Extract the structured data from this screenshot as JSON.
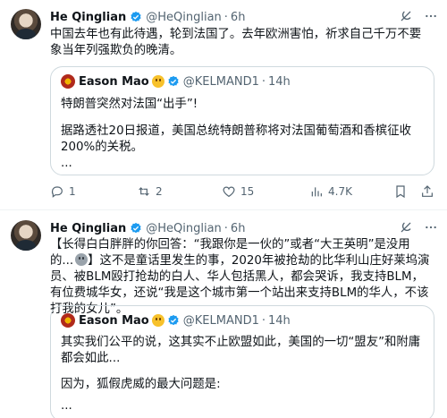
{
  "tweets": [
    {
      "author": {
        "name": "He Qinglian",
        "handle": "@HeQinglian",
        "time": "6h"
      },
      "text": "中国去年也有此待遇，轮到法国了。去年欧洲害怕，祈求自己千万不要象当年列强欺负的晚清。",
      "quote": {
        "author": {
          "name": "Eason Mao",
          "handle": "@KELMAND1",
          "time": "14h"
        },
        "lines": [
          "特朗普突然对法国“出手”!",
          "",
          "据路透社20日报道，美国总统特朗普称将对法国葡萄酒和香槟征收200%的关税。",
          "..."
        ]
      },
      "stats": {
        "replies": "1",
        "reposts": "2",
        "likes": "15",
        "views": "4.7K"
      }
    },
    {
      "author": {
        "name": "He Qinglian",
        "handle": "@HeQinglian",
        "time": "6h"
      },
      "text": "【长得白白胖胖的你回答：“我跟你是一伙的”或者“大王英明”是没用的...",
      "text_end": "】这不是童话里发生的事，2020年被抢劫的比华利山庄好莱坞演员、被BLM殴打抢劫的白人、华人包括黑人，都会哭诉，我支持BLM，有位费城华女，还说“我是这个城市第一个站出来支持BLM的华人，不该打我的女儿”。",
      "quote": {
        "author": {
          "name": "Eason Mao",
          "handle": "@KELMAND1",
          "time": "14h"
        },
        "lines": [
          "其实我们公平的说，这其实不止欧盟如此，美国的一切“盟友”和附庸都会如此...",
          "",
          "因为，狐假虎威的最大问题是:",
          "..."
        ]
      }
    }
  ],
  "dot": "·",
  "colors": {
    "accent": "#1d9bf0",
    "muted": "#536471",
    "border": "#cfd9de"
  },
  "icons": [
    "verified-badge-icon",
    "grok-icon",
    "more-icon",
    "reply-icon",
    "repost-icon",
    "like-icon",
    "views-icon",
    "bookmark-icon",
    "share-icon",
    "emoji-icon"
  ]
}
